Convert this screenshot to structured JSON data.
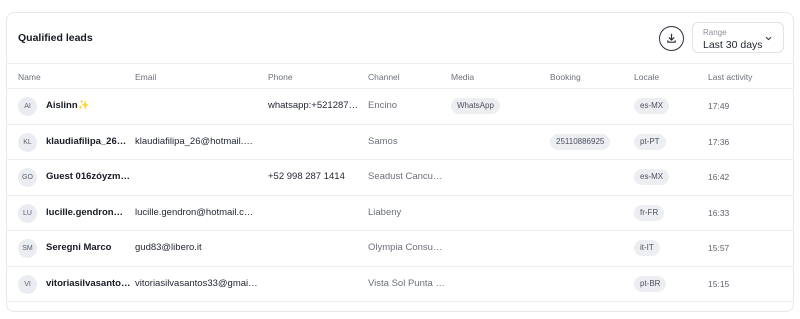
{
  "header": {
    "title": "Qualified leads",
    "download_icon": "download-icon",
    "range": {
      "label": "Range",
      "value": "Last 30 days"
    }
  },
  "columns": [
    "Name",
    "Email",
    "Phone",
    "Channel",
    "Media",
    "Booking",
    "Locale",
    "Last activity"
  ],
  "rows": [
    {
      "initials": "AI",
      "name": "Aislinn✨",
      "email": "",
      "phone": "whatsapp:+521287…",
      "channel": "Encino",
      "media": "WhatsApp",
      "booking": "",
      "locale": "es-MX",
      "last_activity": "17:49"
    },
    {
      "initials": "KL",
      "name": "klaudiafilipa_26…",
      "email": "klaudiafilipa_26@hotmail.…",
      "phone": "",
      "channel": "Samos",
      "media": "",
      "booking": "25110886925",
      "locale": "pt-PT",
      "last_activity": "17:36"
    },
    {
      "initials": "GO",
      "name": "Guest 016zóyzm…",
      "email": "",
      "phone": "+52 998 287 1414",
      "channel": "Seadust Cancu…",
      "media": "",
      "booking": "",
      "locale": "es-MX",
      "last_activity": "16:42"
    },
    {
      "initials": "LU",
      "name": "lucille.gendron…",
      "email": "lucille.gendron@hotmail.c…",
      "phone": "",
      "channel": "Liabeny",
      "media": "",
      "booking": "",
      "locale": "fr-FR",
      "last_activity": "16:33"
    },
    {
      "initials": "SM",
      "name": "Seregni Marco",
      "email": "gud83@libero.it",
      "phone": "",
      "channel": "Olympia Consu…",
      "media": "",
      "booking": "",
      "locale": "it-IT",
      "last_activity": "15:57"
    },
    {
      "initials": "VI",
      "name": "vitoriasilvasanto…",
      "email": "vitoriasilvasantos33@gmai…",
      "phone": "",
      "channel": "Vista Sol Punta …",
      "media": "",
      "booking": "",
      "locale": "pt-BR",
      "last_activity": "15:15"
    }
  ]
}
